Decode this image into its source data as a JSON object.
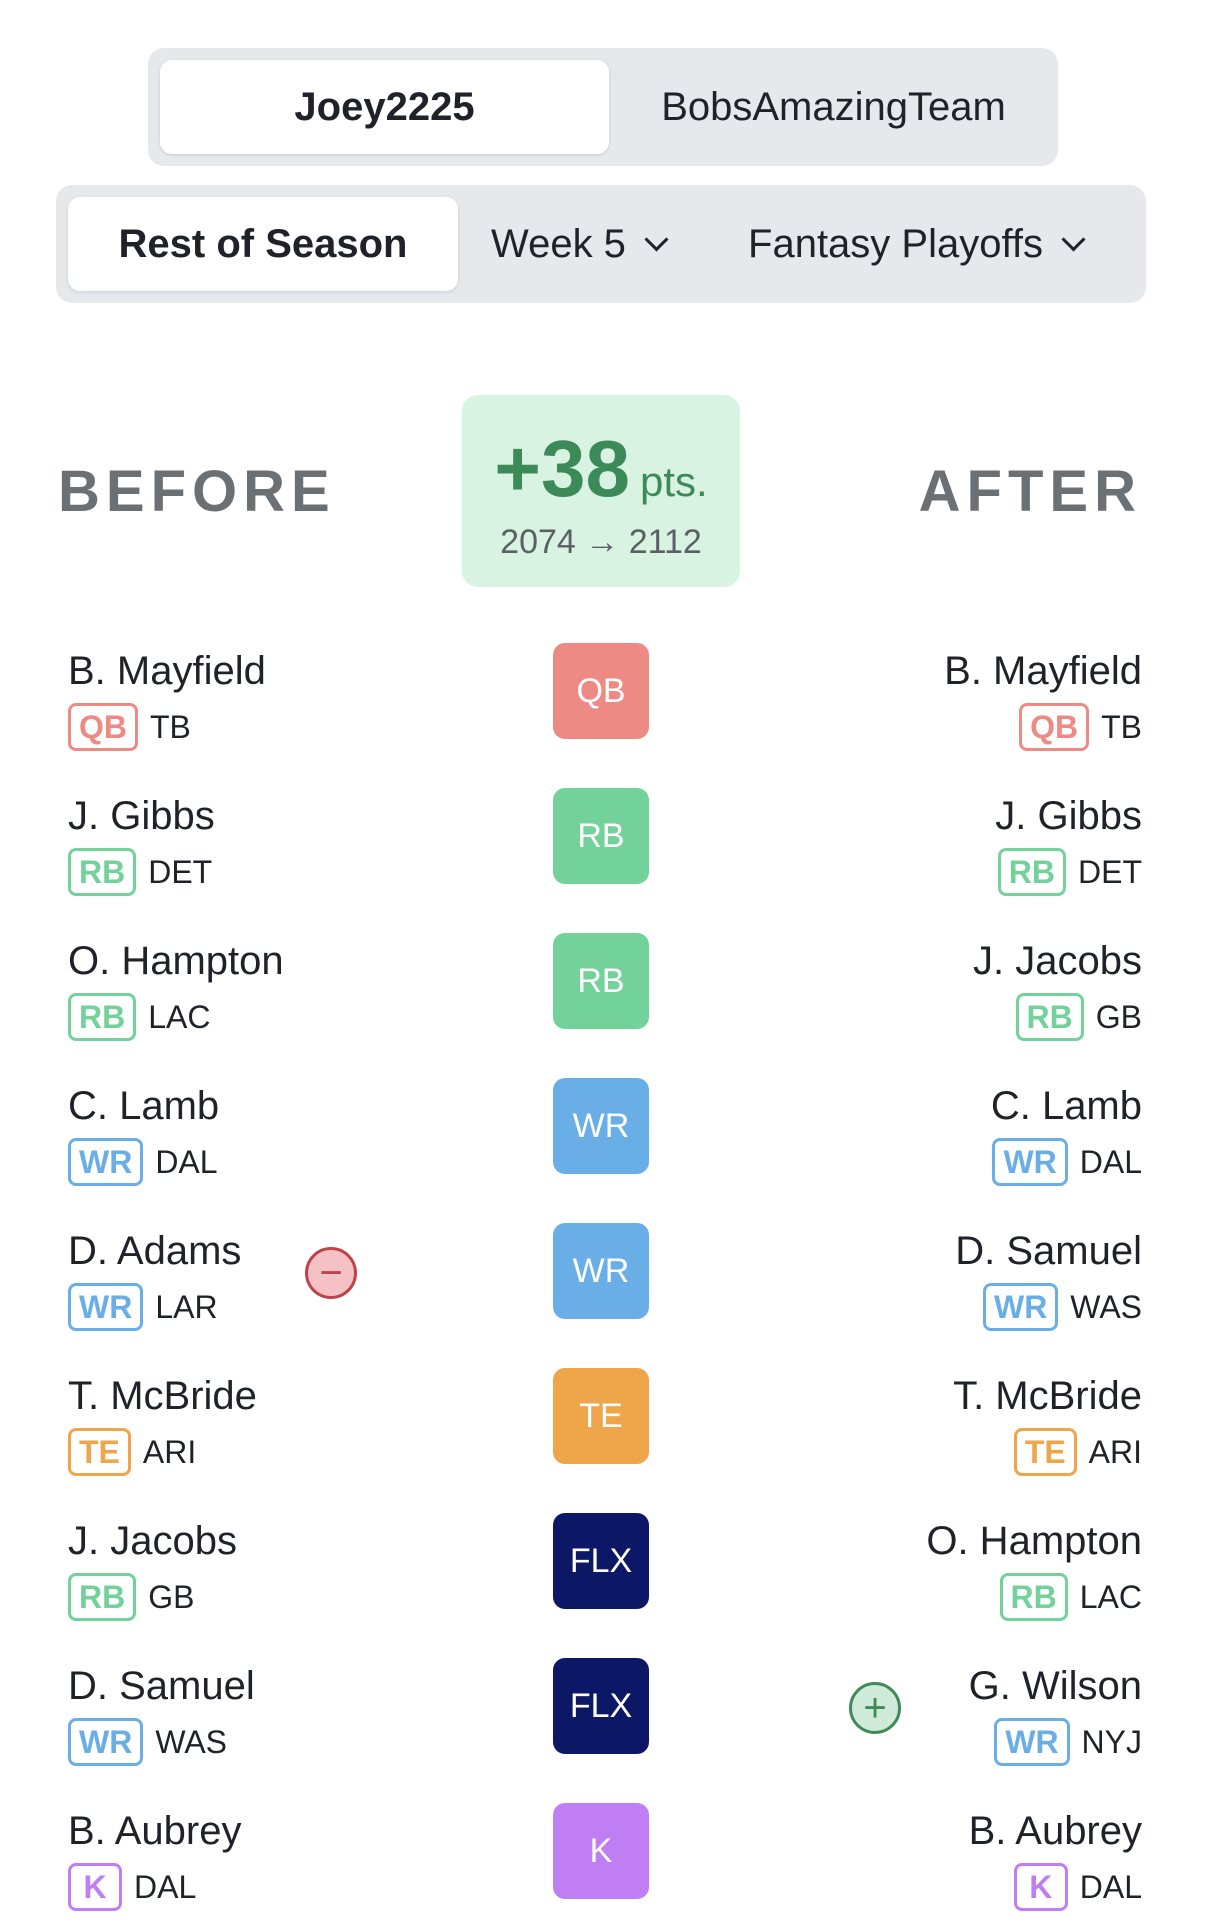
{
  "teams": {
    "selected": "Joey2225",
    "other": "BobsAmazingTeam"
  },
  "range_tabs": {
    "rest_of_season": "Rest of Season",
    "week": "Week 5",
    "fantasy_playoffs": "Fantasy Playoffs"
  },
  "labels": {
    "before": "BEFORE",
    "after": "AFTER"
  },
  "score": {
    "delta": "+38",
    "unit": "pts.",
    "range": "2074 → 2112"
  },
  "colors": {
    "QB": "#ee8a84",
    "RB": "#73d19a",
    "WR": "#6aaee8",
    "TE": "#efa54a",
    "FLX": "#0c1866",
    "K": "#bf7ef3",
    "remove": "#c0414a",
    "add": "#3f8a58",
    "score_bg": "#d9f3e3",
    "score_text": "#3d8a59"
  },
  "rows": [
    {
      "slot": "QB",
      "slot_color": "QB",
      "before": {
        "name": "B. Mayfield",
        "pos": "QB",
        "team": "TB"
      },
      "after": {
        "name": "B. Mayfield",
        "pos": "QB",
        "team": "TB"
      }
    },
    {
      "slot": "RB",
      "slot_color": "RB",
      "before": {
        "name": "J. Gibbs",
        "pos": "RB",
        "team": "DET"
      },
      "after": {
        "name": "J. Gibbs",
        "pos": "RB",
        "team": "DET"
      }
    },
    {
      "slot": "RB",
      "slot_color": "RB",
      "before": {
        "name": "O. Hampton",
        "pos": "RB",
        "team": "LAC"
      },
      "after": {
        "name": "J. Jacobs",
        "pos": "RB",
        "team": "GB"
      }
    },
    {
      "slot": "WR",
      "slot_color": "WR",
      "before": {
        "name": "C. Lamb",
        "pos": "WR",
        "team": "DAL"
      },
      "after": {
        "name": "C. Lamb",
        "pos": "WR",
        "team": "DAL"
      }
    },
    {
      "slot": "WR",
      "slot_color": "WR",
      "action": "remove",
      "action_icon": "minus-icon",
      "action_symbol": "−",
      "before": {
        "name": "D. Adams",
        "pos": "WR",
        "team": "LAR"
      },
      "after": {
        "name": "D. Samuel",
        "pos": "WR",
        "team": "WAS"
      }
    },
    {
      "slot": "TE",
      "slot_color": "TE",
      "before": {
        "name": "T. McBride",
        "pos": "TE",
        "team": "ARI"
      },
      "after": {
        "name": "T. McBride",
        "pos": "TE",
        "team": "ARI"
      }
    },
    {
      "slot": "FLX",
      "slot_color": "FLX",
      "before": {
        "name": "J. Jacobs",
        "pos": "RB",
        "team": "GB"
      },
      "after": {
        "name": "O. Hampton",
        "pos": "RB",
        "team": "LAC"
      }
    },
    {
      "slot": "FLX",
      "slot_color": "FLX",
      "action": "add",
      "action_icon": "plus-icon",
      "action_symbol": "+",
      "before": {
        "name": "D. Samuel",
        "pos": "WR",
        "team": "WAS"
      },
      "after": {
        "name": "G. Wilson",
        "pos": "WR",
        "team": "NYJ"
      }
    },
    {
      "slot": "K",
      "slot_color": "K",
      "before": {
        "name": "B. Aubrey",
        "pos": "K",
        "team": "DAL"
      },
      "after": {
        "name": "B. Aubrey",
        "pos": "K",
        "team": "DAL"
      }
    }
  ]
}
